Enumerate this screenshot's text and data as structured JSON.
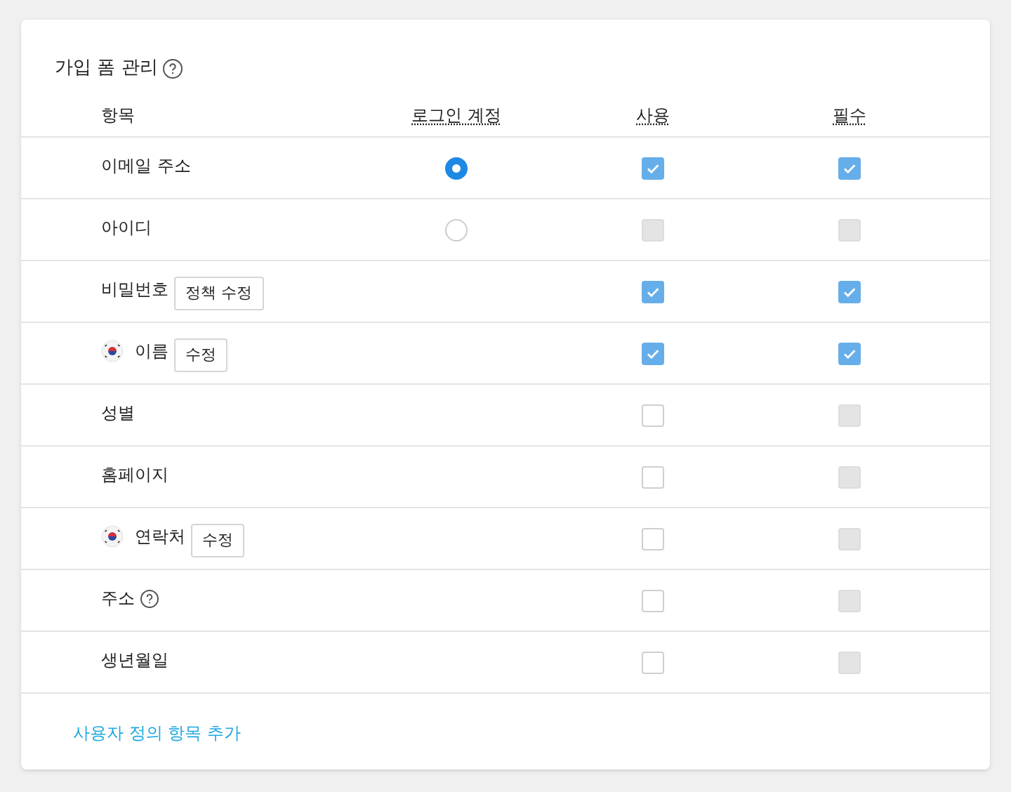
{
  "title": "가입 폼 관리",
  "columns": [
    "항목",
    "로그인 계정",
    "사용",
    "필수"
  ],
  "rows": [
    {
      "label": "이메일 주소",
      "login": {
        "selected": true
      },
      "use": {
        "checked": true,
        "disabled": false
      },
      "required": {
        "checked": true,
        "disabled": false
      }
    },
    {
      "label": "아이디",
      "login": {
        "selected": false
      },
      "use": {
        "checked": false,
        "disabled": true
      },
      "required": {
        "checked": false,
        "disabled": true
      }
    },
    {
      "label": "비밀번호",
      "button": "정책 수정",
      "use": {
        "checked": true,
        "disabled": false
      },
      "required": {
        "checked": true,
        "disabled": false
      }
    },
    {
      "label": "이름",
      "flag": true,
      "button": "수정",
      "use": {
        "checked": true,
        "disabled": false
      },
      "required": {
        "checked": true,
        "disabled": false
      }
    },
    {
      "label": "성별",
      "use": {
        "checked": false,
        "disabled": false
      },
      "required": {
        "checked": false,
        "disabled": true
      }
    },
    {
      "label": "홈페이지",
      "use": {
        "checked": false,
        "disabled": false
      },
      "required": {
        "checked": false,
        "disabled": true
      }
    },
    {
      "label": "연락처",
      "flag": true,
      "button": "수정",
      "use": {
        "checked": false,
        "disabled": false
      },
      "required": {
        "checked": false,
        "disabled": true
      }
    },
    {
      "label": "주소",
      "help": true,
      "use": {
        "checked": false,
        "disabled": false
      },
      "required": {
        "checked": false,
        "disabled": true
      }
    },
    {
      "label": "생년월일",
      "use": {
        "checked": false,
        "disabled": false
      },
      "required": {
        "checked": false,
        "disabled": true
      }
    }
  ],
  "add_link": "사용자 정의 항목 추가"
}
